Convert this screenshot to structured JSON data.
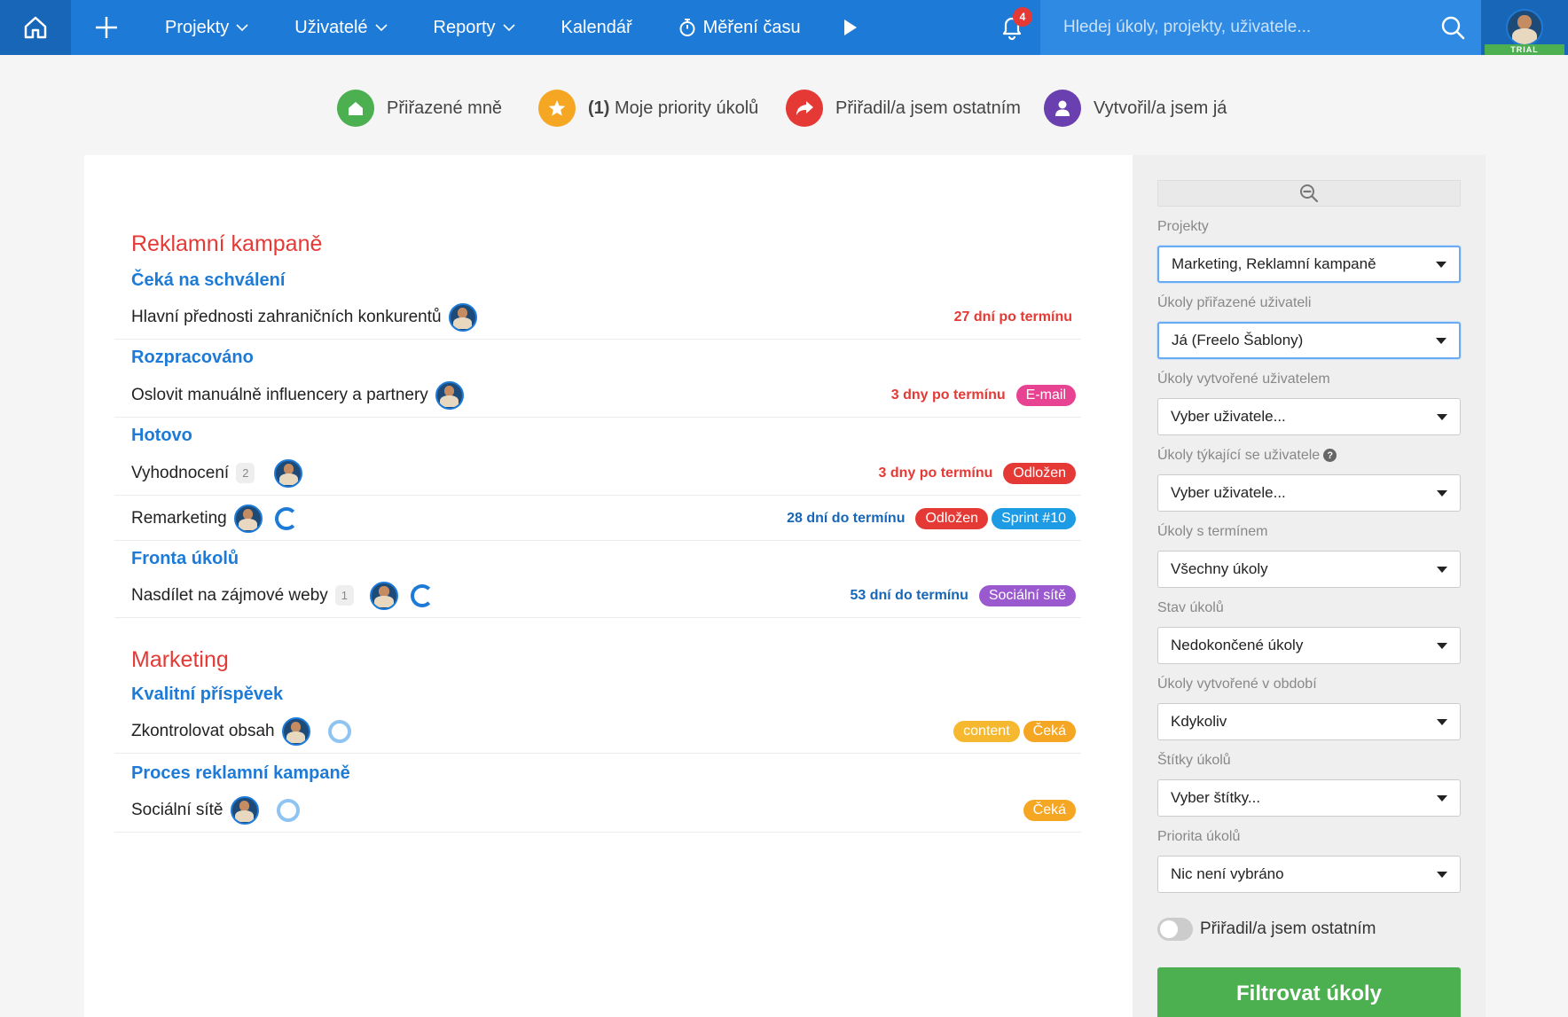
{
  "nav": {
    "projects": "Projekty",
    "users": "Uživatelé",
    "reports": "Reporty",
    "calendar": "Kalendář",
    "time": "Měření času",
    "notifications_count": "4",
    "search_placeholder": "Hledej úkoly, projekty, uživatele...",
    "trial_badge": "TRIAL"
  },
  "quick_filters": {
    "assigned_to_me": "Přiřazené mně",
    "priorities_count": "(1)",
    "priorities": "Moje priority úkolů",
    "assigned_by_me": "Přiřadil/a jsem ostatním",
    "created_by_me": "Vytvořil/a jsem já",
    "colors": {
      "assigned": "#4caf50",
      "priorities": "#f5a623",
      "assigned_by": "#e53935",
      "created": "#6a3fb0"
    }
  },
  "projects": [
    {
      "name": "Reklamní kampaně",
      "lists": [
        {
          "name": "Čeká na schválení",
          "tasks": [
            {
              "name": "Hlavní přednosti zahraničních konkurentů",
              "due": "27 dní po termínu"
            }
          ]
        },
        {
          "name": "Rozpracováno",
          "tasks": [
            {
              "name": "Oslovit manuálně influencery a partnery",
              "due": "3 dny po termínu",
              "tags": [
                "E-mail"
              ]
            }
          ]
        },
        {
          "name": "Hotovo",
          "tasks": [
            {
              "name": "Vyhodnocení",
              "count": "2",
              "due": "3 dny po termínu",
              "tags": [
                "Odložen"
              ]
            },
            {
              "name": "Remarketing",
              "due": "28 dní do termínu",
              "tags": [
                "Odložen",
                "Sprint #10"
              ]
            }
          ]
        },
        {
          "name": "Fronta úkolů",
          "tasks": [
            {
              "name": "Nasdílet na zájmové weby",
              "count": "1",
              "due": "53 dní do termínu",
              "tags": [
                "Sociální sítě"
              ]
            }
          ]
        }
      ]
    },
    {
      "name": "Marketing",
      "lists": [
        {
          "name": "Kvalitní příspěvek",
          "tasks": [
            {
              "name": "Zkontrolovat obsah",
              "tags": [
                "content",
                "Čeká"
              ]
            }
          ]
        },
        {
          "name": "Proces reklamní kampaně",
          "tasks": [
            {
              "name": "Sociální sítě",
              "tags": [
                "Čeká"
              ]
            }
          ]
        }
      ]
    }
  ],
  "tag_colors": {
    "email": "#e84393",
    "odlozen": "#e53935",
    "sprint": "#1e9be5",
    "social": "#9b59d0",
    "content": "#f5b82e",
    "ceka": "#f5a623"
  },
  "sidebar": {
    "filters": [
      {
        "label": "Projekty",
        "value": "Marketing, Reklamní kampaně"
      },
      {
        "label": "Úkoly přiřazené uživateli",
        "value": "Já (Freelo Šablony)"
      },
      {
        "label": "Úkoly vytvořené uživatelem",
        "value": "Vyber uživatele..."
      },
      {
        "label": "Úkoly týkající se uživatele",
        "value": "Vyber uživatele..."
      },
      {
        "label": "Úkoly s termínem",
        "value": "Všechny úkoly"
      },
      {
        "label": "Stav úkolů",
        "value": "Nedokončené úkoly"
      },
      {
        "label": "Úkoly vytvořené v období",
        "value": "Kdykoliv"
      },
      {
        "label": "Štítky úkolů",
        "value": "Vyber štítky..."
      },
      {
        "label": "Priorita úkolů",
        "value": "Nic není vybráno"
      }
    ],
    "help_glyph": "?",
    "toggle_label": "Přiřadil/a jsem ostatním",
    "toggle_on": false,
    "submit_label": "Filtrovat úkoly"
  }
}
